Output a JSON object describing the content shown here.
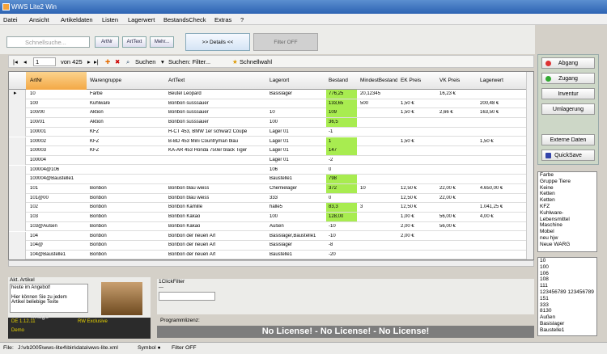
{
  "window": {
    "title": "WWS Lite2 Win"
  },
  "menu": [
    "Datei",
    "Ansicht",
    "Artikeldaten",
    "Listen",
    "Lagerwert",
    "BestandsCheck",
    "Extras",
    "?"
  ],
  "toolbar": {
    "search_placeholder": "Schnellsuche...",
    "btn_artnr": "ArtNr",
    "btn_arttext": "ArtText",
    "btn_mehr": "Mehr...",
    "details": ">> Details <<",
    "filter": "Filter OFF"
  },
  "nav": {
    "position": "1",
    "of": "von 425",
    "suchen": "Suchen",
    "suchen_filter": "Suchen: Filter...",
    "schnellwahl": "Schnellwahl"
  },
  "columns": [
    "ArtNr",
    "Warengruppe",
    "ArtText",
    "Lagerort",
    "Bestand",
    "MindestBestand",
    "EK Preis",
    "VK Preis",
    "Lagerwert"
  ],
  "rows": [
    {
      "c": [
        "10",
        "Farbe",
        "Beutel Leopard",
        "Basislager",
        "776,25",
        "20,12345",
        "",
        "16,23 €",
        ""
      ],
      "g": true,
      "cur": true
    },
    {
      "c": [
        "100",
        "Kuhlware",
        "Bonbon susssauer",
        "",
        "133,65",
        "500",
        "1,50 €",
        "",
        "200,48 €"
      ],
      "g": true
    },
    {
      "c": [
        "100/00",
        "Aktion",
        "Bonbon susssauer",
        "10",
        "109",
        "",
        "1,50 €",
        "2,66 €",
        "163,50 €"
      ],
      "g": true
    },
    {
      "c": [
        "100/01",
        "Aktion",
        "Bonbon susssauer",
        "100",
        "36,5",
        "",
        "",
        "",
        ""
      ],
      "g": true
    },
    {
      "c": [
        "100001",
        "KFZ",
        "H-CT 453, BMW 1er schwarz Coupe",
        "Lager 01",
        "-1",
        "",
        "",
        "",
        ""
      ],
      "g": false
    },
    {
      "c": [
        "100002",
        "KFZ",
        "B-BD 453 Mini Countryman blau",
        "Lager 01",
        "1",
        "",
        "1,50 €",
        "",
        "1,50 €"
      ],
      "g": true
    },
    {
      "c": [
        "100003",
        "KFZ",
        "KA-AR 453 Honda 750er black Tiger",
        "Lager 01",
        "147",
        "",
        "",
        "",
        ""
      ],
      "g": true
    },
    {
      "c": [
        "100004",
        "",
        "",
        "Lager 01",
        "-2",
        "",
        "",
        "",
        ""
      ],
      "g": false
    },
    {
      "c": [
        "100004@106",
        "",
        "",
        "106",
        "0",
        "",
        "",
        "",
        ""
      ],
      "g": false
    },
    {
      "c": [
        "100004@Baustelle1",
        "",
        "",
        "Baustelle1",
        "798",
        "",
        "",
        "",
        ""
      ],
      "g": true
    },
    {
      "c": [
        "101",
        "Bonbon",
        "Bonbon blau weiss",
        "Chemielager",
        "372",
        "10",
        "12,50 €",
        "22,00 €",
        "4.650,00 €"
      ],
      "g": true
    },
    {
      "c": [
        "101@00",
        "Bonbon",
        "Bonbon blau weiss",
        "333",
        "0",
        "",
        "12,50 €",
        "22,00 €",
        ""
      ],
      "g": false
    },
    {
      "c": [
        "102",
        "Bonbon",
        "Bonbon Kamille",
        "halle5",
        "83,3",
        "3",
        "12,50 €",
        "",
        "1.041,25 €"
      ],
      "g": true
    },
    {
      "c": [
        "103",
        "Bonbon",
        "Bonbon Kakao",
        "100",
        "128,00",
        "",
        "1,00 €",
        "56,00 €",
        "4,00 €"
      ],
      "g": true
    },
    {
      "c": [
        "103@Außen",
        "Bonbon",
        "Bonbon Kakao",
        "Außen",
        "-10",
        "",
        "2,00 €",
        "56,00 €",
        ""
      ],
      "g": false
    },
    {
      "c": [
        "104",
        "Bonbon",
        "Bonbon der neuen Art",
        "Basislager,Baustelle1",
        "-10",
        "",
        "2,00 €",
        "",
        ""
      ],
      "g": false
    },
    {
      "c": [
        "104@",
        "Bonbon",
        "Bonbon der neuen Art",
        "Basislager",
        "-8",
        "",
        "",
        "",
        ""
      ],
      "g": false
    },
    {
      "c": [
        "104@Baustelle1",
        "Bonbon",
        "Bonbon der neuen Art",
        "Baustelle1",
        "-20",
        "",
        "",
        "",
        ""
      ],
      "g": false
    }
  ],
  "right": {
    "abgang": "Abgang",
    "zugang": "Zugang",
    "inventur": "Inventur",
    "umlagerung": "Umlagerung",
    "externe": "Externe Daten",
    "quicksave": "QuickSave"
  },
  "list1": [
    "Farbe",
    "Gruppe Tiere",
    "Keine",
    "Ketten",
    "Ketten",
    "KFZ",
    "Kuhlware-",
    "Lebensmittel",
    "Maschine",
    "Mobel",
    "neu hjw",
    "Neue WARG"
  ],
  "list2": [
    "10",
    "100",
    "106",
    "108",
    "111",
    "123456789 123456789",
    "151",
    "333",
    "8130",
    "Außen",
    "Basislager",
    "Baustelle1"
  ],
  "akt": {
    "label": "Akt. Artikel",
    "t1": "heute im Angebot!",
    "t2": "Hier können Sie zu jedem",
    "t3": "Artikel beliebige Texte",
    "de": "DE 1.12.11",
    "exclusive": "RW Exclusive",
    "demo": "Demo",
    "image": "Image"
  },
  "oneclick": {
    "label": "1ClickFilter",
    "dash": "---"
  },
  "license": {
    "label": "Programmlizenz:",
    "text": "No License! - No License! - No License!"
  },
  "status": {
    "file": "File:",
    "path": "J:\\vb2005\\wws-lite4\\bin\\data\\wws-lite.xml",
    "symbol": "Symbol ●",
    "filter": "Filter OFF"
  }
}
